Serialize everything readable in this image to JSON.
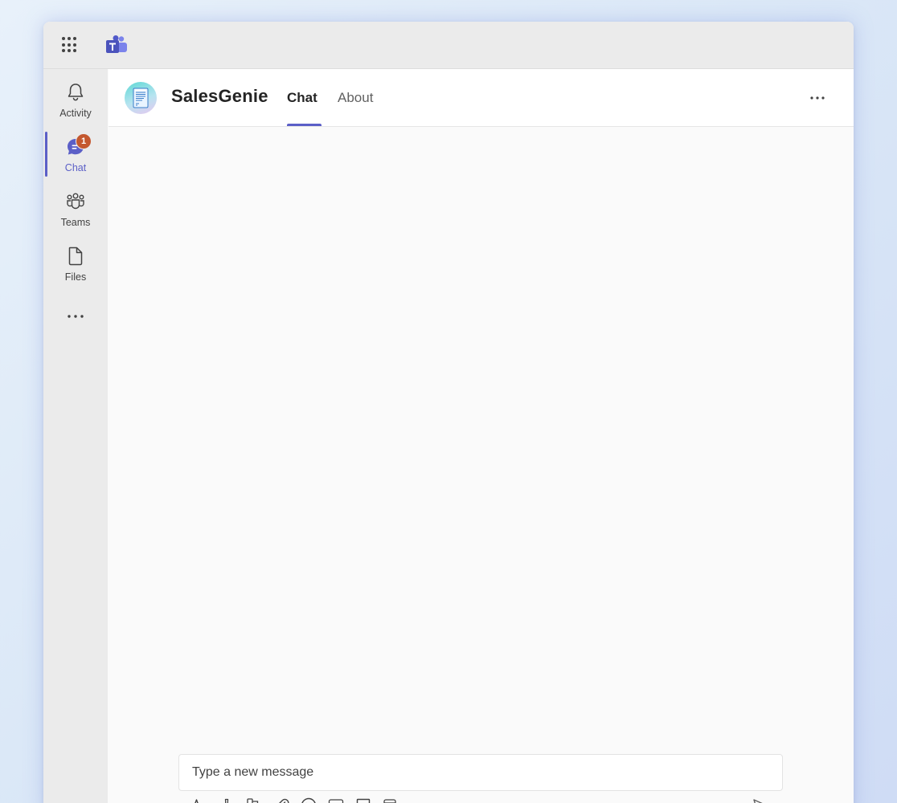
{
  "app": {
    "name": "SalesGenie",
    "accent_color": "#5b5fc7",
    "badge_color": "#c4582f"
  },
  "titlebar": {
    "icons": [
      "app-launcher-icon",
      "teams-logo-icon"
    ]
  },
  "rail": {
    "items": [
      {
        "label": "Activity",
        "icon": "bell-icon"
      },
      {
        "label": "Chat",
        "icon": "chat-icon",
        "active": true,
        "badge": "1"
      },
      {
        "label": "Teams",
        "icon": "teams-icon"
      },
      {
        "label": "Files",
        "icon": "file-icon"
      }
    ],
    "more_icon": "more-icon"
  },
  "header": {
    "title": "SalesGenie",
    "tabs": [
      {
        "label": "Chat",
        "active": true
      },
      {
        "label": "About",
        "active": false
      }
    ],
    "more_icon": "more-options-icon"
  },
  "compose": {
    "placeholder": "Type a new message",
    "value": ""
  },
  "toolbar": {
    "icons": [
      "format-icon",
      "priority-icon",
      "loop-icon",
      "attach-icon",
      "emoji-icon",
      "gif-icon",
      "sticker-icon",
      "schedule-meeting-icon",
      "more-actions-icon"
    ],
    "send_icon": "send-icon"
  }
}
